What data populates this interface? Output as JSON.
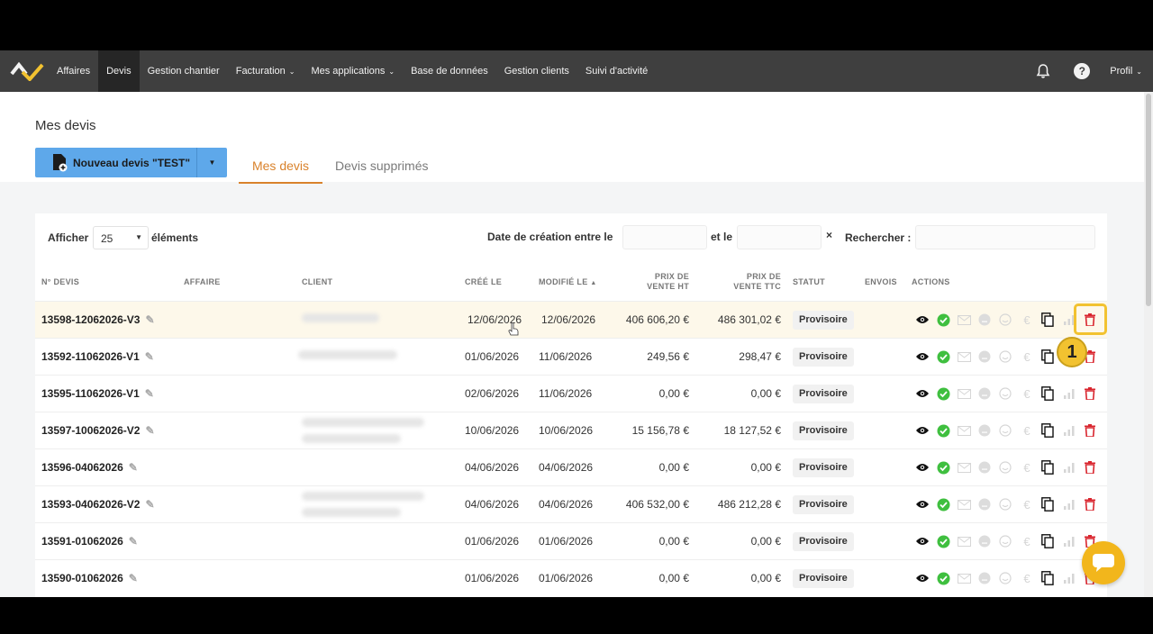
{
  "nav": {
    "items": [
      {
        "label": "Affaires"
      },
      {
        "label": "Devis",
        "active": true
      },
      {
        "label": "Gestion chantier"
      },
      {
        "label": "Facturation",
        "dropdown": true
      },
      {
        "label": "Mes applications",
        "dropdown": true
      },
      {
        "label": "Base de données"
      },
      {
        "label": "Gestion clients"
      },
      {
        "label": "Suivi d'activité"
      }
    ],
    "profile_label": "Profil",
    "help_label": "?"
  },
  "header": {
    "title": "Mes devis",
    "new_button_label": "Nouveau devis \"TEST\"",
    "tabs": [
      {
        "label": "Mes devis",
        "active": true
      },
      {
        "label": "Devis supprimés"
      }
    ]
  },
  "filters": {
    "show_label": "Afficher",
    "page_size": "25",
    "elements_label": "éléments",
    "date_label": "Date de création entre le",
    "and_label": "et le",
    "clear_icon": "×",
    "search_label": "Rechercher :"
  },
  "table": {
    "headers": {
      "num": "N° DEVIS",
      "affaire": "AFFAIRE",
      "client": "CLIENT",
      "created": "CRÉÉ LE",
      "modified": "MODIFIÉ LE",
      "ht_line1": "PRIX DE",
      "ht_line2": "VENTE HT",
      "ttc_line1": "PRIX DE",
      "ttc_line2": "VENTE TTC",
      "status": "STATUT",
      "envois": "ENVOIS",
      "actions": "ACTIONS"
    },
    "rows": [
      {
        "num": "13598-12062026-V3",
        "created": "12/06/2026",
        "modified": "12/06/2026",
        "ht": "406 606,20 €",
        "ttc": "486 301,02 €",
        "status": "Provisoire"
      },
      {
        "num": "13592-11062026-V1",
        "created": "01/06/2026",
        "modified": "11/06/2026",
        "ht": "249,56 €",
        "ttc": "298,47 €",
        "status": "Provisoire"
      },
      {
        "num": "13595-11062026-V1",
        "created": "02/06/2026",
        "modified": "11/06/2026",
        "ht": "0,00 €",
        "ttc": "0,00 €",
        "status": "Provisoire"
      },
      {
        "num": "13597-10062026-V2",
        "created": "10/06/2026",
        "modified": "10/06/2026",
        "ht": "15 156,78 €",
        "ttc": "18 127,52 €",
        "status": "Provisoire"
      },
      {
        "num": "13596-04062026",
        "created": "04/06/2026",
        "modified": "04/06/2026",
        "ht": "0,00 €",
        "ttc": "0,00 €",
        "status": "Provisoire"
      },
      {
        "num": "13593-04062026-V2",
        "created": "04/06/2026",
        "modified": "04/06/2026",
        "ht": "406 532,00 €",
        "ttc": "486 212,28 €",
        "status": "Provisoire"
      },
      {
        "num": "13591-01062026",
        "created": "01/06/2026",
        "modified": "01/06/2026",
        "ht": "0,00 €",
        "ttc": "0,00 €",
        "status": "Provisoire"
      },
      {
        "num": "13590-01062026",
        "created": "01/06/2026",
        "modified": "01/06/2026",
        "ht": "0,00 €",
        "ttc": "0,00 €",
        "status": "Provisoire"
      }
    ]
  },
  "annotation": {
    "marker_label": "1"
  },
  "colors": {
    "nav_bg": "#3f3f3f",
    "accent_orange": "#d9822b",
    "button_blue": "#5ea8ea",
    "highlight_yellow": "#f2c230",
    "delete_red": "#d9262f",
    "success_green": "#3fbf3f"
  }
}
